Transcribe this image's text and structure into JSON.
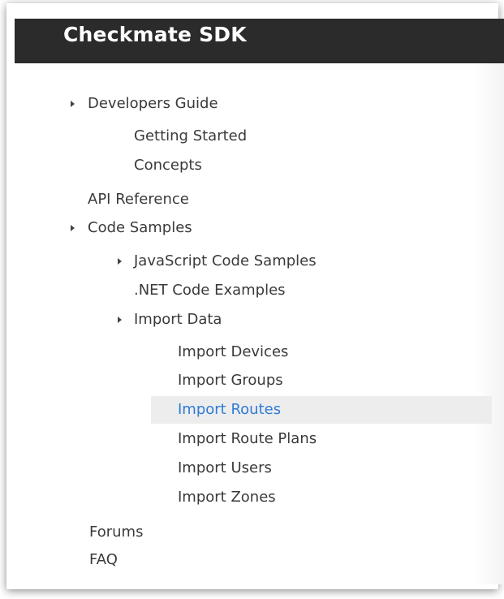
{
  "header": {
    "title": "Checkmate SDK"
  },
  "nav": {
    "developers_guide": "Developers Guide",
    "getting_started": "Getting Started",
    "concepts": "Concepts",
    "api_reference": "API Reference",
    "code_samples": "Code Samples",
    "javascript_code_samples": "JavaScript Code Samples",
    "net_code_examples": ".NET Code Examples",
    "import_data": "Import Data",
    "import_devices": "Import Devices",
    "import_groups": "Import Groups",
    "import_routes": "Import Routes",
    "import_route_plans": "Import Route Plans",
    "import_users": "Import Users",
    "import_zones": "Import Zones",
    "forums": "Forums",
    "faq": "FAQ"
  },
  "colors": {
    "header_bg": "#2b2b2b",
    "active_link": "#2e7bd6",
    "text": "#3a3a3a"
  },
  "icons": {
    "expand_caret": "caret-right-icon"
  }
}
